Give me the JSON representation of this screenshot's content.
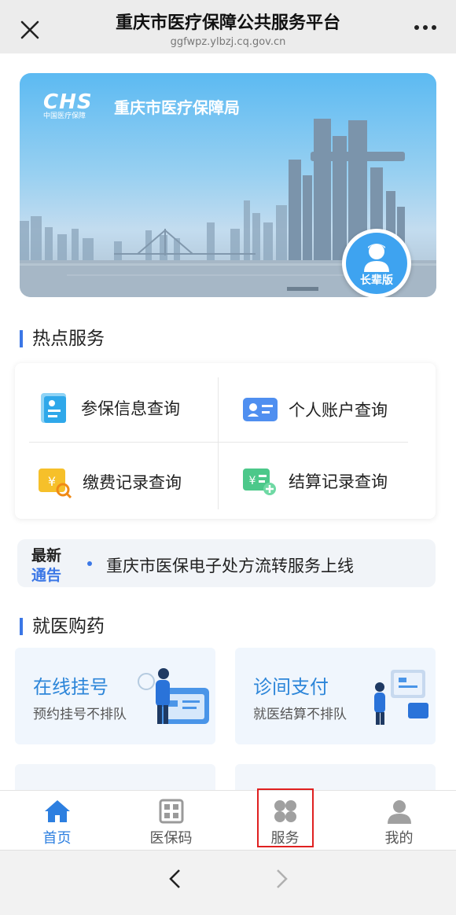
{
  "header": {
    "title": "重庆市医疗保障公共服务平台",
    "url": "ggfwpz.ylbzj.cq.gov.cn"
  },
  "banner": {
    "logo_text": "CHS",
    "logo_sub": "中国医疗保障",
    "bureau": "重庆市医疗保障局",
    "elder_label": "长辈版"
  },
  "hot_services": {
    "title": "热点服务",
    "items": [
      {
        "label": "参保信息查询",
        "icon": "insurance-info-icon"
      },
      {
        "label": "个人账户查询",
        "icon": "id-card-icon"
      },
      {
        "label": "缴费记录查询",
        "icon": "payment-search-icon"
      },
      {
        "label": "结算记录查询",
        "icon": "settlement-record-icon"
      }
    ]
  },
  "notice": {
    "tag_line1": "最新",
    "tag_line2": "通告",
    "text": "重庆市医保电子处方流转服务上线"
  },
  "medical": {
    "title": "就医购药",
    "cards": [
      {
        "title": "在线挂号",
        "subtitle": "预约挂号不排队"
      },
      {
        "title": "诊间支付",
        "subtitle": "就医结算不排队"
      }
    ]
  },
  "tabbar": {
    "tabs": [
      {
        "label": "首页",
        "icon": "home-icon"
      },
      {
        "label": "医保码",
        "icon": "qr-code-icon"
      },
      {
        "label": "服务",
        "icon": "services-grid-icon"
      },
      {
        "label": "我的",
        "icon": "user-icon"
      }
    ]
  },
  "colors": {
    "accent": "#2d7fe0",
    "highlight": "#e02020"
  }
}
